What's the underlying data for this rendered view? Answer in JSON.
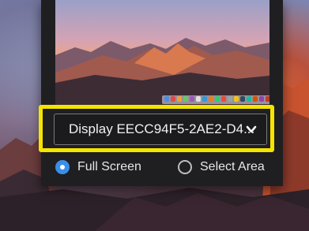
{
  "display_select": {
    "value": "Display EECC94F5-2AE2-D4..."
  },
  "capture_mode": {
    "options": [
      {
        "label": "Full Screen",
        "selected": true
      },
      {
        "label": "Select Area",
        "selected": false
      }
    ]
  },
  "colors": {
    "highlight": "#f5e400",
    "radio_selected": "#3b8ee8",
    "panel": "#1f1f22"
  },
  "icons": {
    "dropdown": "chevron-down-icon"
  }
}
